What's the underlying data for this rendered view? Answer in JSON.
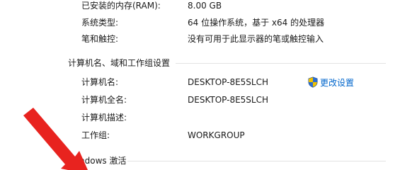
{
  "system": {
    "ram_label": "已安装的内存(RAM):",
    "ram_value": "8.00 GB",
    "type_label": "系统类型:",
    "type_value": "64 位操作系统，基于 x64 的处理器",
    "pen_label": "笔和触控:",
    "pen_value": "没有可用于此显示器的笔或触控输入"
  },
  "computer_name": {
    "section_title": "计算机名、域和工作组设置",
    "name_label": "计算机名:",
    "name_value": "DESKTOP-8E5SLCH",
    "full_name_label": "计算机全名:",
    "full_name_value": "DESKTOP-8E5SLCH",
    "description_label": "计算机描述:",
    "description_value": "",
    "workgroup_label": "工作组:",
    "workgroup_value": "WORKGROUP",
    "change_settings_label": "更改设置",
    "change_settings_icon": "uac-shield-icon"
  },
  "activation": {
    "section_title": "ndows 激活"
  },
  "colors": {
    "link": "#0066cc",
    "annotation_arrow": "#e8231f",
    "shield_blue": "#2f6fd0",
    "shield_yellow": "#f2c200"
  }
}
